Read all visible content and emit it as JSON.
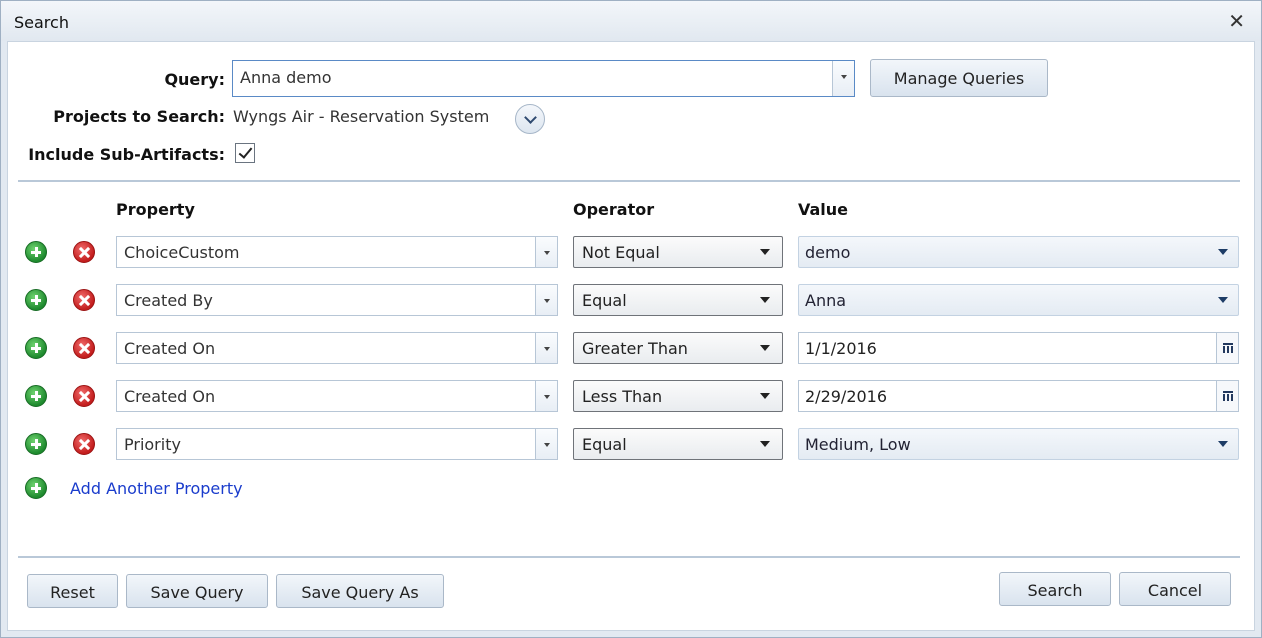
{
  "dialog": {
    "title": "Search"
  },
  "header": {
    "query_label": "Query:",
    "query_value": "Anna demo",
    "manage_queries": "Manage Queries",
    "projects_label": "Projects to Search:",
    "projects_value": "Wyngs Air - Reservation System",
    "subartifacts_label": "Include Sub-Artifacts:",
    "subartifacts_checked": true
  },
  "columns": {
    "property": "Property",
    "operator": "Operator",
    "value": "Value"
  },
  "rows": [
    {
      "property": "ChoiceCustom",
      "operator": "Not Equal",
      "value": "demo",
      "value_type": "select"
    },
    {
      "property": "Created By",
      "operator": "Equal",
      "value": "Anna",
      "value_type": "select"
    },
    {
      "property": "Created On",
      "operator": "Greater Than",
      "value": "1/1/2016",
      "value_type": "date"
    },
    {
      "property": "Created On",
      "operator": "Less Than",
      "value": "2/29/2016",
      "value_type": "date"
    },
    {
      "property": "Priority",
      "operator": "Equal",
      "value": "Medium, Low",
      "value_type": "select"
    }
  ],
  "add_property": "Add Another Property",
  "footer": {
    "reset": "Reset",
    "save_query": "Save Query",
    "save_query_as": "Save Query As",
    "search": "Search",
    "cancel": "Cancel"
  },
  "icons": {
    "close": "close-icon",
    "add": "add-icon",
    "remove": "remove-icon",
    "expand": "chevron-down-icon",
    "calendar": "calendar-icon"
  }
}
